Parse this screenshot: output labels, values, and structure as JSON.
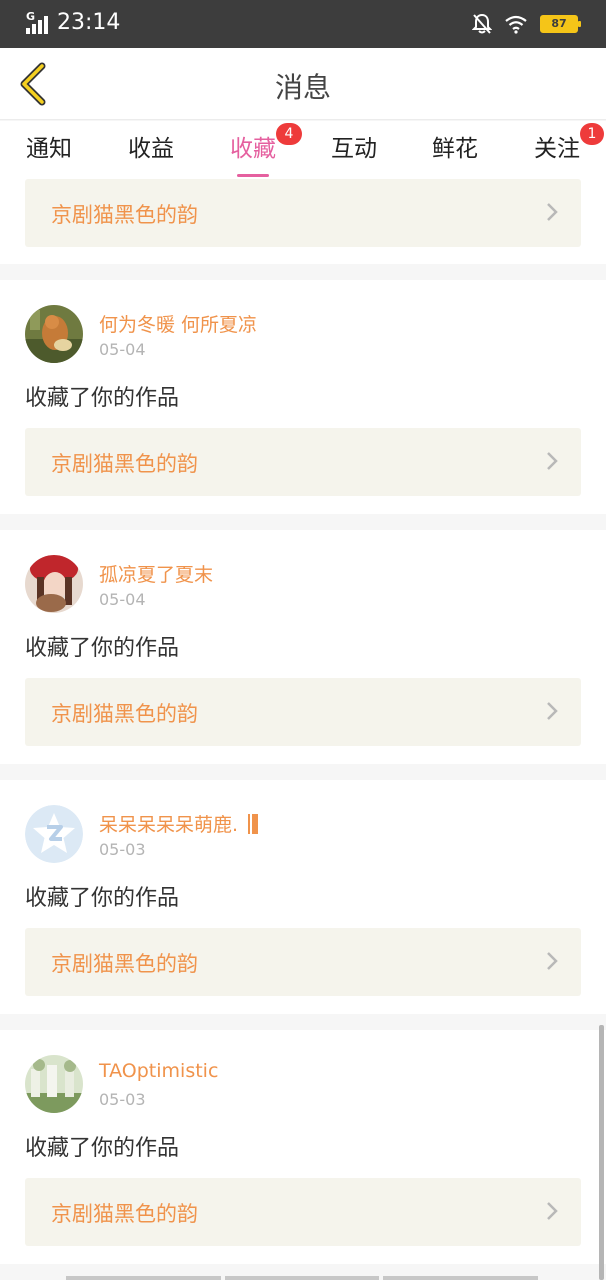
{
  "status_bar": {
    "network_type": "G",
    "time": "23:14",
    "battery": "87"
  },
  "header": {
    "title": "消息"
  },
  "tabs": [
    {
      "label": "通知",
      "badge": ""
    },
    {
      "label": "收益",
      "badge": ""
    },
    {
      "label": "收藏",
      "badge": "4",
      "active": true
    },
    {
      "label": "互动",
      "badge": ""
    },
    {
      "label": "鲜花",
      "badge": ""
    },
    {
      "label": "关注",
      "badge": "1"
    }
  ],
  "partial_item": {
    "work_title": "京剧猫黑色的韵"
  },
  "items": [
    {
      "username": "何为冬暖 何所夏凉",
      "date": "05-04",
      "action": "收藏了你的作品",
      "work_title": "京剧猫黑色的韵"
    },
    {
      "username": "孤凉夏了夏末",
      "date": "05-04",
      "action": "收藏了你的作品",
      "work_title": "京剧猫黑色的韵"
    },
    {
      "username": "呆呆呆呆呆萌鹿.",
      "date": "05-03",
      "action": "收藏了你的作品",
      "work_title": "京剧猫黑色的韵"
    },
    {
      "username": "TAOptimistic",
      "date": "05-03",
      "action": "收藏了你的作品",
      "work_title": "京剧猫黑色的韵"
    }
  ],
  "colors": {
    "accent": "#e5609f",
    "username": "#f0934b",
    "badge": "#ee3b3b",
    "link_bg": "#f5f4ec"
  }
}
